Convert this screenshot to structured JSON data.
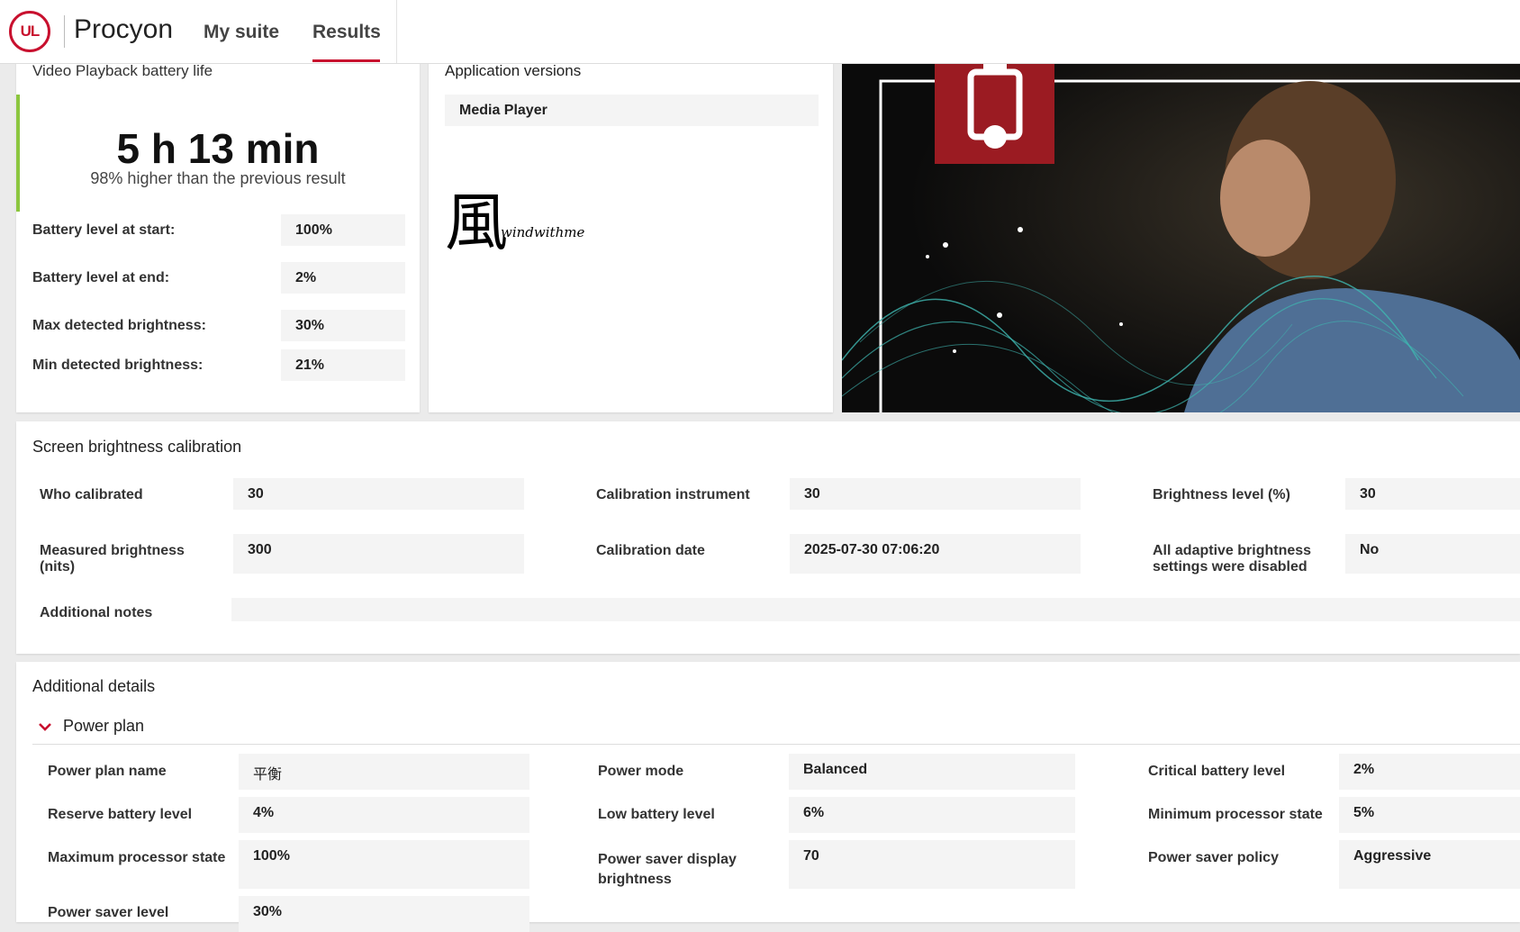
{
  "header": {
    "brand": "Procyon",
    "logo_text": "UL",
    "nav": [
      {
        "label": "My suite"
      },
      {
        "label": "Results",
        "active": true
      }
    ],
    "accent_color": "#c8102e"
  },
  "battery_card": {
    "title": "Video Playback battery life",
    "score": "5 h 13 min",
    "comparison": "98% higher than the previous result",
    "rows": [
      {
        "label": "Battery level at start:",
        "value": "100%"
      },
      {
        "label": "Battery level at end:",
        "value": "2%"
      },
      {
        "label": "Max detected brightness:",
        "value": "30%"
      },
      {
        "label": "Min detected brightness:",
        "value": "21%"
      }
    ]
  },
  "versions_card": {
    "title": "Application versions",
    "items": [
      "Media Player"
    ],
    "signature": {
      "glyph": "風",
      "text": "windwithme"
    }
  },
  "calibration": {
    "title": "Screen brightness calibration",
    "fields": [
      {
        "label": "Who calibrated",
        "value": "30"
      },
      {
        "label": "Calibration instrument",
        "value": "30"
      },
      {
        "label": "Brightness level (%)",
        "value": "30"
      },
      {
        "label": "Measured brightness (nits)",
        "value": "300"
      },
      {
        "label": "Calibration date",
        "value": "2025-07-30 07:06:20"
      },
      {
        "label": "All adaptive brightness settings were disabled",
        "value": "No"
      }
    ],
    "notes_label": "Additional notes",
    "notes_value": ""
  },
  "details": {
    "title": "Additional details",
    "section": "Power plan",
    "fields": [
      {
        "label": "Power plan name",
        "value": "平衡"
      },
      {
        "label": "Power mode",
        "value": "Balanced"
      },
      {
        "label": "Critical battery level",
        "value": "2%"
      },
      {
        "label": "Reserve battery level",
        "value": "4%"
      },
      {
        "label": "Low battery level",
        "value": "6%"
      },
      {
        "label": "Minimum processor state",
        "value": "5%"
      },
      {
        "label": "Maximum processor state",
        "value": "100%"
      },
      {
        "label": "Power saver display brightness",
        "value": "70"
      },
      {
        "label": "Power saver policy",
        "value": "Aggressive"
      },
      {
        "label": "Power saver level",
        "value": "30%"
      }
    ]
  }
}
